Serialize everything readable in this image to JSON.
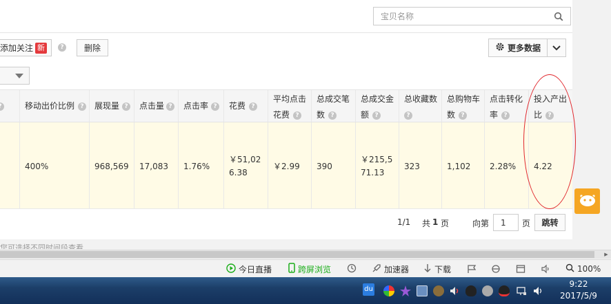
{
  "search": {
    "placeholder": "宝贝名称",
    "icon": "search-icon"
  },
  "toolbar": {
    "add_follow_label": "添加关注",
    "new_badge": "新",
    "delete_label": "删除",
    "more_data_label": "更多数据"
  },
  "table": {
    "headers": [
      {
        "line1": "移动出价比例",
        "line2": ""
      },
      {
        "line1": "展现量",
        "line2": ""
      },
      {
        "line1": "点击量",
        "line2": ""
      },
      {
        "line1": "点击率",
        "line2": ""
      },
      {
        "line1": "花费",
        "line2": ""
      },
      {
        "line1": "平均点击",
        "line2": "花费"
      },
      {
        "line1": "总成交笔",
        "line2": "数"
      },
      {
        "line1": "总成交金",
        "line2": "额"
      },
      {
        "line1": "总收藏数",
        "line2": ""
      },
      {
        "line1": "总购物车",
        "line2": "数"
      },
      {
        "line1": "点击转化",
        "line2": "率"
      },
      {
        "line1": "投入产出",
        "line2": "比"
      }
    ],
    "row": [
      {
        "line1": "400%",
        "line2": ""
      },
      {
        "line1": "968,569",
        "line2": ""
      },
      {
        "line1": "17,083",
        "line2": ""
      },
      {
        "line1": "1.76%",
        "line2": ""
      },
      {
        "line1": "￥51,02",
        "line2": "6.38"
      },
      {
        "line1": "￥2.99",
        "line2": ""
      },
      {
        "line1": "390",
        "line2": ""
      },
      {
        "line1": "￥215,5",
        "line2": "71.13"
      },
      {
        "line1": "323",
        "line2": ""
      },
      {
        "line1": "1,102",
        "line2": ""
      },
      {
        "line1": "2.28%",
        "line2": ""
      },
      {
        "line1": "4.22",
        "line2": ""
      }
    ]
  },
  "pager": {
    "current": "1/1",
    "total_prefix": "共",
    "total_pages": "1",
    "total_suffix": "页",
    "goto_prefix": "向第",
    "goto_value": "1",
    "goto_suffix": "页",
    "jump_label": "跳转"
  },
  "footer_ghost_text": "您可选择不同时间段查看",
  "statusbar": {
    "live_label": "今日直播",
    "cross_screen_label": "跨屏浏览",
    "accelerator_label": "加速器",
    "download_label": "下载",
    "zoom": "100%"
  },
  "taskbar": {
    "time": "9:22",
    "date": "2017/5/9"
  },
  "colors": {
    "highlight_row": "#fffbe6",
    "annotation_red": "#e0242a",
    "badge_red": "#e4393c",
    "green_accent": "#1aad19",
    "widget_orange": "#f5a623"
  }
}
